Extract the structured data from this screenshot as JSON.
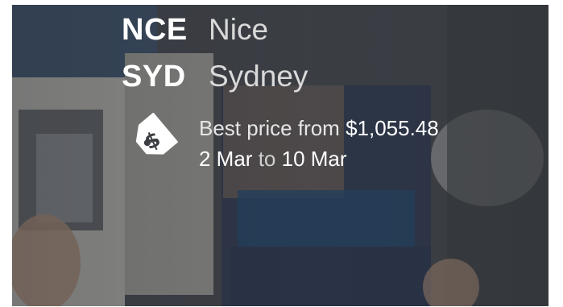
{
  "route": {
    "origin": {
      "code": "NCE",
      "city": "Nice"
    },
    "destination": {
      "code": "SYD",
      "city": "Sydney"
    }
  },
  "price": {
    "label": "Best price from",
    "amount": "$1,055.48",
    "icon": "price-tag-icon"
  },
  "dates": {
    "start": "2 Mar",
    "connector": "to",
    "end": "10 Mar"
  },
  "colors": {
    "text_primary": "#ffffff",
    "text_secondary": "#d9d9d9",
    "overlay": "#2a2c30"
  }
}
